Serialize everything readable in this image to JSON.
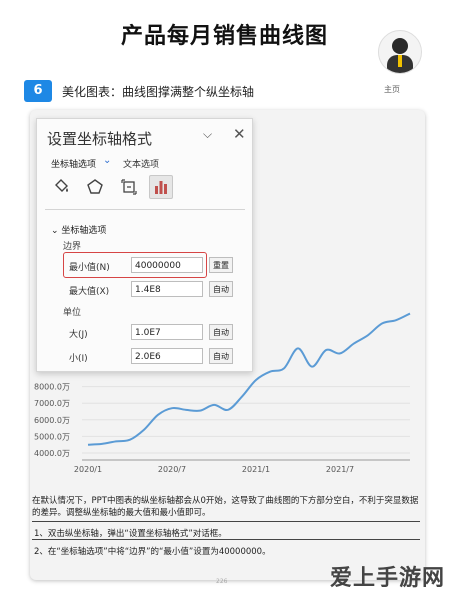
{
  "header": {
    "title": "产品每月销售曲线图",
    "home_label": "主页",
    "step_number": "6",
    "step_text": "美化图表：曲线图撑满整个纵坐标轴"
  },
  "dialog": {
    "title": "设置坐标轴格式",
    "tab_axis_options": "坐标轴选项",
    "tab_text_options": "文本选项",
    "icons": [
      "fill-bucket-icon",
      "pentagon-effects-icon",
      "size-properties-icon",
      "bar-chart-icon"
    ],
    "section_label": "坐标轴选项",
    "bounds_label": "边界",
    "min_label": "最小值(N)",
    "min_value": "40000000",
    "min_button": "重置",
    "max_label": "最大值(X)",
    "max_value": "1.4E8",
    "max_button": "自动",
    "units_label": "单位",
    "major_label": "大(J)",
    "major_value": "1.0E7",
    "major_button": "自动",
    "minor_label": "小(I)",
    "minor_value": "2.0E6",
    "minor_button": "自动"
  },
  "chart_data": {
    "type": "line",
    "x_ticks": [
      "2020/1",
      "2020/7",
      "2021/1",
      "2021/7"
    ],
    "y_ticks_visible": [
      "4000.0万",
      "5000.0万",
      "6000.0万",
      "7000.0万",
      "8000.0万"
    ],
    "ylim": [
      4000,
      14000
    ],
    "y_unit": "万",
    "series": [
      {
        "x": [
          "2020/1",
          "2020/2",
          "2020/3",
          "2020/4",
          "2020/5",
          "2020/6",
          "2020/7",
          "2020/8",
          "2020/9",
          "2020/10",
          "2020/11",
          "2020/12",
          "2021/1",
          "2021/2",
          "2021/3",
          "2021/4",
          "2021/5",
          "2021/6",
          "2021/7",
          "2021/8",
          "2021/9",
          "2021/10",
          "2021/11",
          "2021/12"
        ],
        "values": [
          4500,
          4550,
          4700,
          4800,
          5400,
          6300,
          6700,
          6600,
          6550,
          6900,
          6600,
          7400,
          8400,
          8900,
          9100,
          10300,
          9200,
          10200,
          10000,
          10600,
          11100,
          11800,
          12000,
          12400
        ],
        "color": "#5b9bd5"
      }
    ]
  },
  "description": "在默认情况下，PPT中图表的纵坐标轴都会从0开始，这导致了曲线图的下方部分空白，不利于突显数据的差异。调整纵坐标轴的最大值和最小值即可。",
  "steps": [
    "1、双击纵坐标轴，弹出“设置坐标轴格式”对话框。",
    "2、在“坐标轴选项”中将“边界”的“最小值”设置为40000000。"
  ],
  "page_number": "226",
  "watermark": "爱上手游网"
}
